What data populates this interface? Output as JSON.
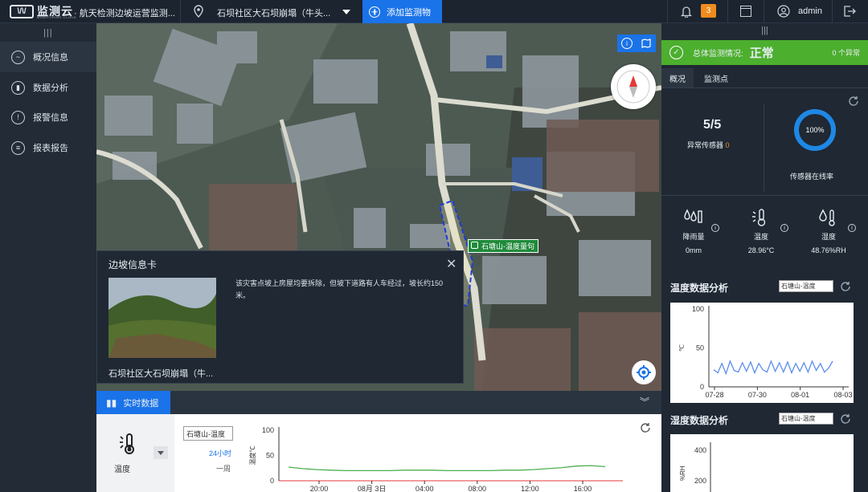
{
  "topbar": {
    "logo_mark": "\\/\\/",
    "logo_text": "监测云",
    "logo_subtext": "MONITORING CLOUD",
    "app_title": "· 航天检测边坡运营监测...",
    "site_name": "石坝社区大石坝崩塌（牛头...",
    "add_label": "添加监测物",
    "alert_count": "3",
    "username": "admin"
  },
  "sidebar": {
    "items": [
      {
        "label": "概况信息",
        "icon": "overview-icon"
      },
      {
        "label": "数据分析",
        "icon": "analysis-icon"
      },
      {
        "label": "报警信息",
        "icon": "alarm-icon"
      },
      {
        "label": "报表报告",
        "icon": "report-icon"
      }
    ]
  },
  "map": {
    "marker_label": "石塘山-温度量句"
  },
  "info_card": {
    "title": "边坡信息卡",
    "description": "该灾害点坡上房屋均要拆除，但坡下道路有人车经过，坡长约150米。",
    "site_name": "石坝社区大石坝崩塌（牛..."
  },
  "realtime": {
    "tab_label": "实时数据",
    "tile_label": "温度",
    "sensor_select": "石塘山-温度",
    "range_24h": "24小时",
    "range_week": "一周",
    "chart_data": {
      "type": "line",
      "title": "",
      "xlabel": "",
      "ylabel": "温度℃",
      "ylim": [
        0,
        100
      ],
      "yticks": [
        0,
        50,
        100
      ],
      "x_ticks": [
        "20:00",
        "08月 3日",
        "04:00",
        "08:00",
        "12:00",
        "16:00"
      ],
      "series": [
        {
          "color": "#4caf50",
          "values": [
            27,
            24,
            22,
            21,
            20,
            20,
            20,
            20,
            21,
            21,
            21,
            20,
            20,
            20,
            20,
            21,
            21,
            22,
            24,
            26,
            29,
            30,
            28
          ]
        }
      ]
    }
  },
  "right_panel": {
    "status_label": "总体监测情况:",
    "status_value": "正常",
    "abnormal_count": "0 个异常",
    "tabs": [
      "概况",
      "监测点"
    ],
    "sensor_ratio": "5/5",
    "abnormal_label": "异常传感器",
    "abnormal_value": "0",
    "online_pct": "100%",
    "online_value": 1.0,
    "online_label": "传感器在线率",
    "sensors": [
      {
        "name": "降雨量",
        "value": "0mm",
        "icon": "rain-gauge-icon"
      },
      {
        "name": "温度",
        "value": "28.96°C",
        "icon": "thermometer-icon"
      },
      {
        "name": "湿度",
        "value": "48.76%RH",
        "icon": "humidity-icon"
      }
    ],
    "analysis1": {
      "title": "温度数据分析",
      "select": "石塘山-温度",
      "chart_data": {
        "type": "line",
        "title": "",
        "xlabel": "",
        "ylabel": "℃",
        "ylim": [
          0,
          100
        ],
        "yticks": [
          0,
          50,
          100
        ],
        "x_ticks": [
          "07-28",
          "07-30",
          "08-01",
          "08-03"
        ],
        "series": [
          {
            "color": "#5b8def",
            "values": [
              22,
              18,
              30,
              17,
              33,
              21,
              19,
              31,
              20,
              32,
              18,
              30,
              22,
              19,
              33,
              20,
              31,
              19,
              32,
              18,
              30,
              20,
              31,
              19,
              33,
              21,
              30,
              19,
              24,
              33
            ]
          }
        ]
      }
    },
    "analysis2": {
      "title": "湿度数据分析",
      "select": "石塘山-温度",
      "ylabel": "%RH",
      "yticks_visible": [
        "400",
        "200"
      ]
    }
  }
}
